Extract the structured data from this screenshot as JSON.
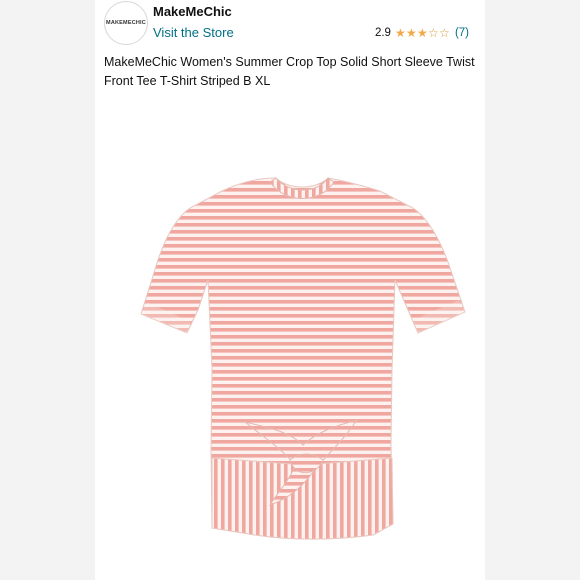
{
  "store": {
    "logo_text": "MAKEMECHIC",
    "name": "MakeMeChic",
    "visit_label": "Visit the Store"
  },
  "rating": {
    "score": "2.9",
    "stars_filled": 3,
    "stars_total": 5,
    "count": "(7)"
  },
  "product": {
    "title": "MakeMeChic Women's Summer Crop Top Solid Short Sleeve Twist Front Tee T-Shirt Striped B XL",
    "colors": {
      "stripe": "#f0a7a0",
      "base": "#fdf2ef"
    }
  },
  "icons": {
    "star_filled": "★",
    "star_empty": "☆"
  }
}
